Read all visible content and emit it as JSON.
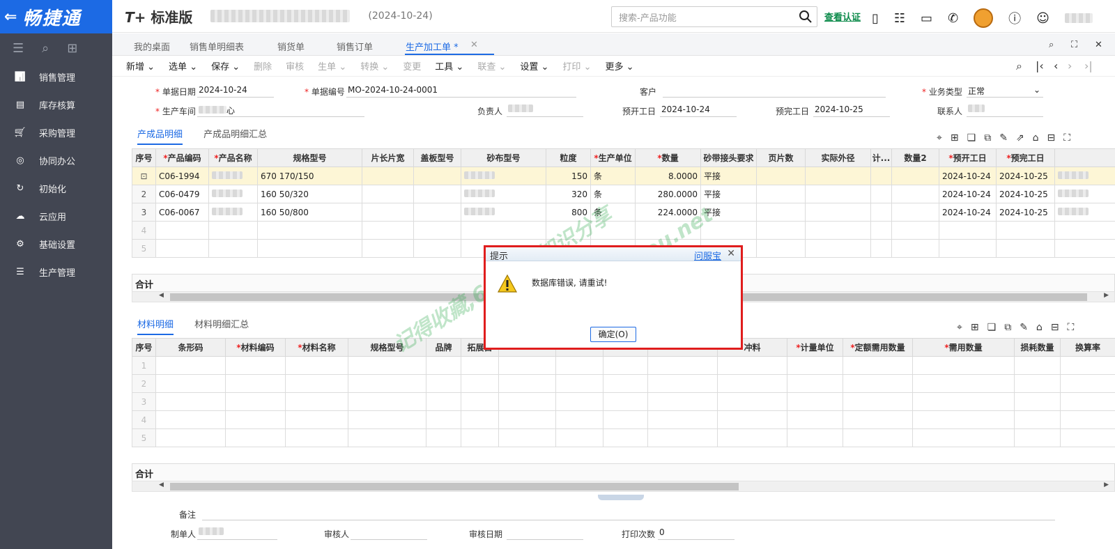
{
  "app": {
    "logo_text": "畅捷通",
    "brand": "标准版",
    "brand_mark": "T+",
    "date_header": "(2024-10-24)"
  },
  "search": {
    "placeholder": "搜索-产品功能"
  },
  "verify_link": "查看认证",
  "sidebar": {
    "items": [
      {
        "label": "销售管理",
        "icon": "chart-icon"
      },
      {
        "label": "库存核算",
        "icon": "warehouse-icon"
      },
      {
        "label": "采购管理",
        "icon": "cart-icon"
      },
      {
        "label": "协同办公",
        "icon": "target-icon"
      },
      {
        "label": "初始化",
        "icon": "refresh-icon"
      },
      {
        "label": "云应用",
        "icon": "cloud-icon"
      },
      {
        "label": "基础设置",
        "icon": "gear-icon"
      },
      {
        "label": "生产管理",
        "icon": "sliders-icon"
      }
    ]
  },
  "tabs": [
    {
      "label": "我的桌面"
    },
    {
      "label": "销售单明细表"
    },
    {
      "label": "销货单"
    },
    {
      "label": "销售订单"
    },
    {
      "label": "生产加工单 *",
      "active": true
    }
  ],
  "toolbar": {
    "items": [
      {
        "label": "新增",
        "arrow": true,
        "enabled": true
      },
      {
        "label": "选单",
        "arrow": true,
        "enabled": true
      },
      {
        "label": "保存",
        "arrow": true,
        "enabled": true
      },
      {
        "label": "删除",
        "arrow": false,
        "enabled": false
      },
      {
        "label": "审核",
        "arrow": false,
        "enabled": false
      },
      {
        "label": "生单",
        "arrow": true,
        "enabled": false
      },
      {
        "label": "转换",
        "arrow": true,
        "enabled": false
      },
      {
        "label": "变更",
        "arrow": false,
        "enabled": false
      },
      {
        "label": "工具",
        "arrow": true,
        "enabled": true
      },
      {
        "label": "联查",
        "arrow": true,
        "enabled": false
      },
      {
        "label": "设置",
        "arrow": true,
        "enabled": true
      },
      {
        "label": "打印",
        "arrow": true,
        "enabled": false
      },
      {
        "label": "更多",
        "arrow": true,
        "enabled": true
      }
    ]
  },
  "form": {
    "doc_date_label": "单据日期",
    "doc_date": "2024-10-24",
    "doc_no_label": "单据编号",
    "doc_no": "MO-2024-10-24-0001",
    "customer_label": "客户",
    "biz_type_label": "业务类型",
    "biz_type": "正常",
    "workshop_label": "生产车间",
    "workshop": "心",
    "owner_label": "负责人",
    "plan_start_label": "预开工日",
    "plan_start": "2024-10-24",
    "plan_end_label": "预完工日",
    "plan_end": "2024-10-25",
    "contact_label": "联系人"
  },
  "product_section": {
    "tab1": "产成品明细",
    "tab2": "产成品明细汇总"
  },
  "product_table": {
    "headers": [
      "序号",
      "产品编码",
      "产品名称",
      "规格型号",
      "片长片宽",
      "盖板型号",
      "砂布型号",
      "粒度",
      "生产单位",
      "数量",
      "砂带接头要求",
      "页片数",
      "实际外径",
      "计...",
      "数量2",
      "预开工日",
      "预完工日"
    ],
    "required": [
      false,
      true,
      true,
      false,
      false,
      false,
      false,
      false,
      true,
      true,
      false,
      false,
      false,
      false,
      false,
      true,
      true
    ],
    "rows": [
      {
        "idx": "",
        "code": "C06-1994",
        "spec": "670 170/150",
        "grit": "150",
        "unit": "条",
        "qty": "8.0000",
        "joint": "平接",
        "start": "2024-10-24",
        "end": "2024-10-25"
      },
      {
        "idx": "2",
        "code": "C06-0479",
        "spec": "160 50/320",
        "grit": "320",
        "unit": "条",
        "qty": "280.0000",
        "joint": "平接",
        "start": "2024-10-24",
        "end": "2024-10-25"
      },
      {
        "idx": "3",
        "code": "C06-0067",
        "spec": "160 50/800",
        "grit": "800",
        "unit": "条",
        "qty": "224.0000",
        "joint": "平接",
        "start": "2024-10-24",
        "end": "2024-10-25"
      },
      {
        "idx": "4"
      },
      {
        "idx": "5"
      }
    ]
  },
  "sum_label": "合计",
  "material_section": {
    "tab1": "材料明细",
    "tab2": "材料明细汇总"
  },
  "material_table": {
    "headers": [
      "序号",
      "条形码",
      "材料编码",
      "材料名称",
      "规格型号",
      "品牌",
      "拓展自",
      "",
      "",
      "",
      "",
      "冲料",
      "计量单位",
      "定额需用数量",
      "需用数量",
      "损耗数量",
      "换算率"
    ],
    "required": [
      false,
      false,
      true,
      true,
      false,
      false,
      false,
      false,
      false,
      false,
      false,
      false,
      true,
      true,
      true,
      false,
      false
    ],
    "rows": [
      "1",
      "2",
      "3",
      "4",
      "5"
    ]
  },
  "footer": {
    "remark_label": "备注",
    "maker_label": "制单人",
    "auditor_label": "审核人",
    "audit_date_label": "审核日期",
    "print_count_label": "打印次数",
    "print_count": "0"
  },
  "dialog": {
    "title": "提示",
    "help_link": "问服宝",
    "message": "数据库错误, 请重试!",
    "ok_label": "确定(O)"
  },
  "watermark": {
    "line1": "记得收藏,6号社区知识分享",
    "line2": "www.hifangyou.net"
  }
}
